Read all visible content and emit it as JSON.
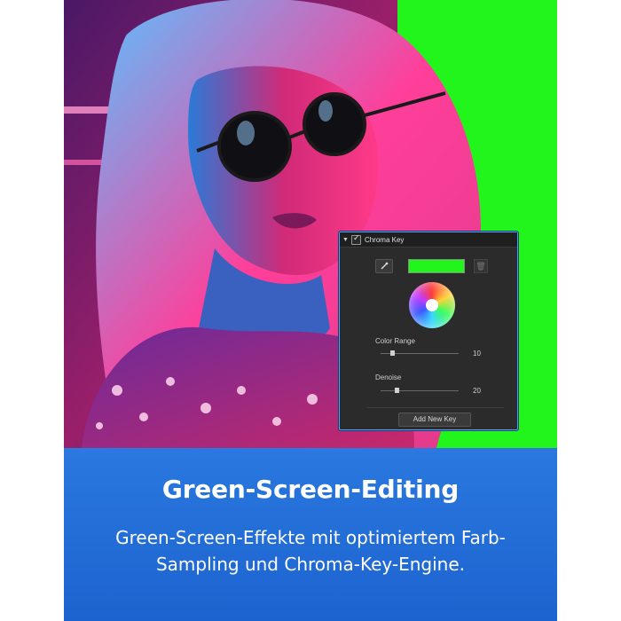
{
  "panel": {
    "title": "Chroma Key",
    "enabled": true,
    "key_color": "#22f51c",
    "color_range": {
      "label": "Color Range",
      "value": "10"
    },
    "denoise": {
      "label": "Denoise",
      "value": "20"
    },
    "add_key_label": "Add New Key"
  },
  "caption": {
    "title": "Green-Screen-Editing",
    "body": "Green-Screen-Effekte mit optimiertem Farb-Sampling und Chroma-Key-Engine."
  },
  "colors": {
    "green_screen": "#22f51c",
    "caption_bg": "#2a78e0",
    "panel_border": "#4aa0ff"
  }
}
